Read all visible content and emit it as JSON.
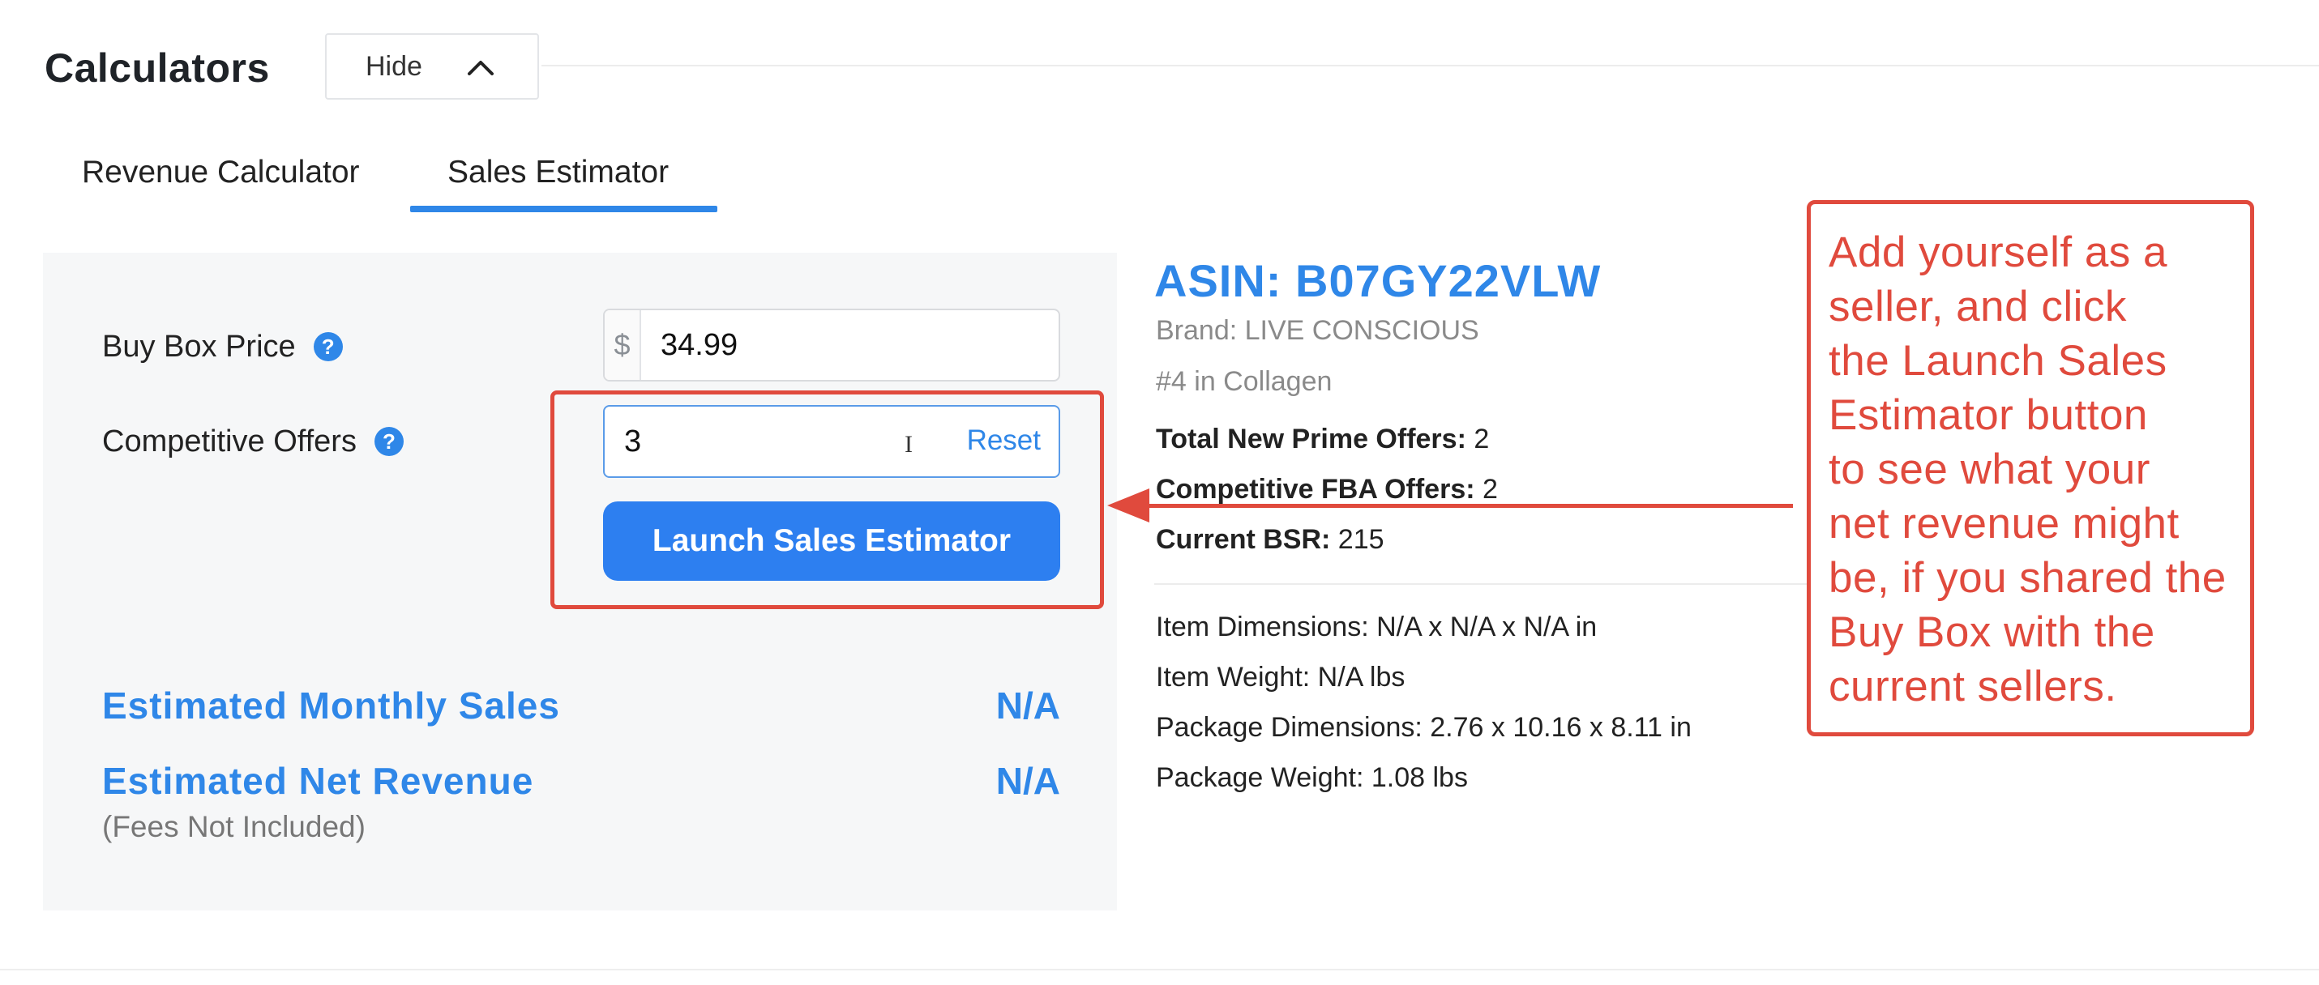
{
  "header": {
    "title": "Calculators",
    "hide_label": "Hide",
    "hide_icon": "chevron-up-icon"
  },
  "tabs": [
    {
      "label": "Revenue Calculator",
      "active": false
    },
    {
      "label": "Sales Estimator",
      "active": true
    }
  ],
  "form": {
    "buy_box_price_label": "Buy Box Price",
    "price_prefix": "$",
    "buy_box_price_value": "34.99",
    "competitive_offers_label": "Competitive Offers",
    "competitive_offers_value": "3",
    "reset_label": "Reset",
    "launch_button_label": "Launch Sales Estimator",
    "help_icon_glyph": "?"
  },
  "estimates": {
    "monthly_sales_label": "Estimated Monthly Sales",
    "monthly_sales_value": "N/A",
    "net_revenue_label": "Estimated Net Revenue",
    "net_revenue_value": "N/A",
    "fees_note": "(Fees Not Included)"
  },
  "product": {
    "asin": "ASIN: B07GY22VLW",
    "brand": "Brand: LIVE CONSCIOUS",
    "rank": "#4 in Collagen",
    "total_new_prime_offers_label": "Total New Prime Offers:",
    "total_new_prime_offers_value": "2",
    "competitive_fba_offers_label": "Competitive FBA Offers:",
    "competitive_fba_offers_value": "2",
    "current_bsr_label": "Current BSR:",
    "current_bsr_value": "215",
    "item_dimensions": "Item Dimensions: N/A x N/A x N/A in",
    "item_weight": "Item Weight: N/A lbs",
    "package_dimensions": "Package Dimensions: 2.76 x 10.16 x 8.11 in",
    "package_weight": "Package Weight: 1.08 lbs"
  },
  "annotation": {
    "text": "Add yourself as a\nseller, and click\nthe Launch Sales\nEstimator button\nto see what your\nnet revenue might\nbe, if you shared the\nBuy Box with the\ncurrent sellers.",
    "color": "#e04a3d"
  },
  "colors": {
    "accent": "#2f87e8",
    "button": "#2d7ff0",
    "annotation": "#e04a3d",
    "panel_bg": "#f6f7f8"
  }
}
